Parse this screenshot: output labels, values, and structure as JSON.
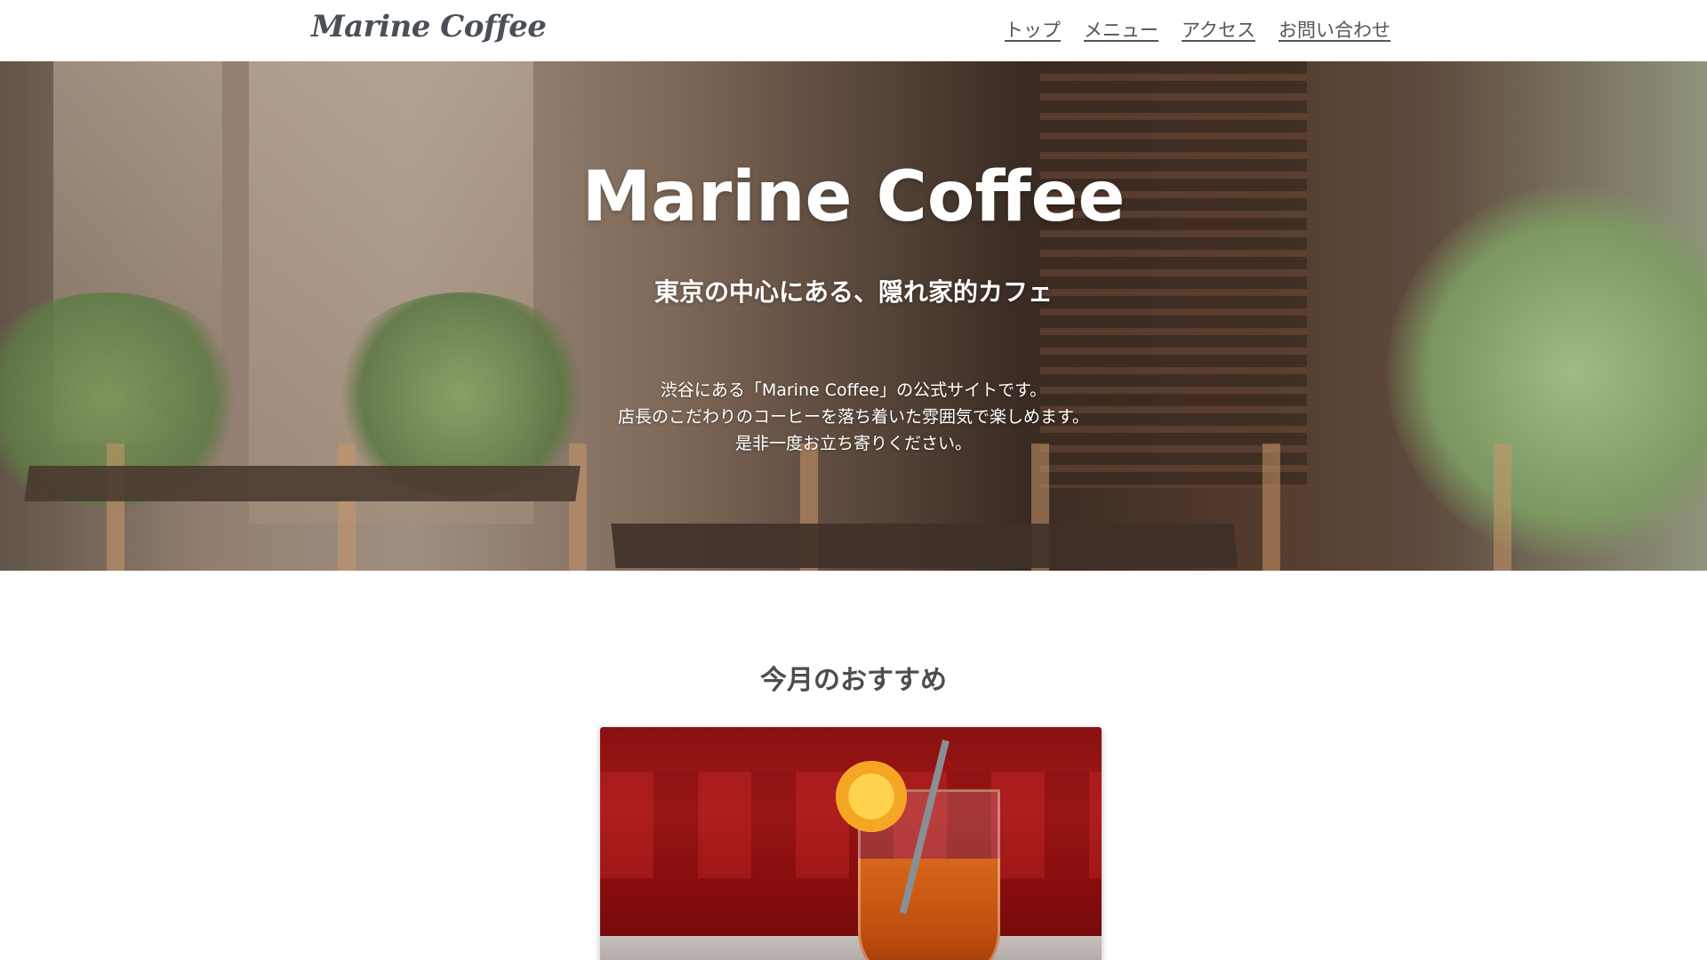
{
  "header": {
    "logo": "Marine Coffee",
    "nav": [
      {
        "label": "トップ"
      },
      {
        "label": "メニュー"
      },
      {
        "label": "アクセス"
      },
      {
        "label": "お問い合わせ"
      }
    ]
  },
  "hero": {
    "title": "Marine Coffee",
    "subtitle": "東京の中心にある、隠れ家的カフェ",
    "description": [
      "渋谷にある「Marine Coffee」の公式サイトです。",
      "店長のこだわりのコーヒーを落ち着いた雰囲気で楽しめます。",
      "是非一度お立ち寄りください。"
    ]
  },
  "recommend": {
    "title": "今月のおすすめ"
  },
  "colors": {
    "header_bg": "#ffffff",
    "text": "#4d4d4d",
    "hero_text": "#ffffff",
    "card_accent": "#8a1010"
  }
}
